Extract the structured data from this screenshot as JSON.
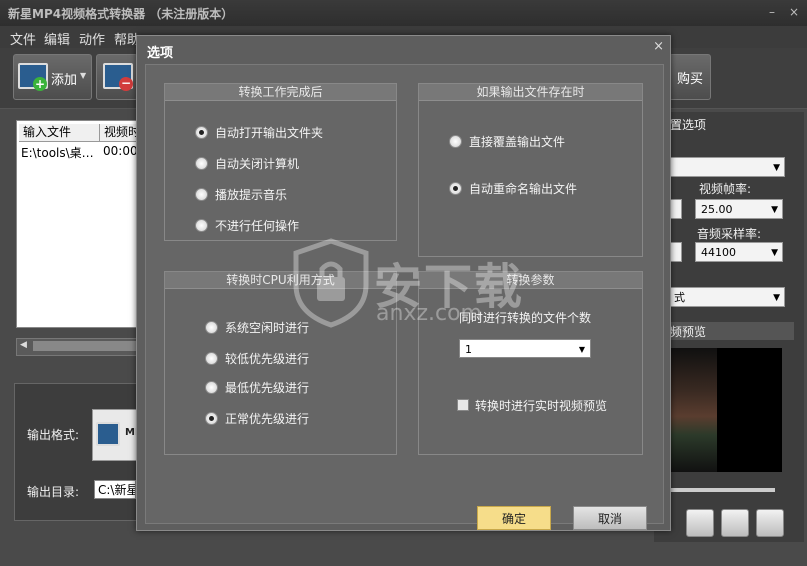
{
  "app": {
    "title": "新星MP4视频格式转换器 （未注册版本）",
    "menu": [
      "文件",
      "编辑",
      "动作",
      "帮助"
    ],
    "toolbar": {
      "add_label": "添加",
      "buy_label": "购买"
    }
  },
  "file_list": {
    "columns": [
      "输入文件",
      "视频时"
    ],
    "rows": [
      [
        "E:\\tools\\桌…",
        "00:00:"
      ]
    ]
  },
  "output": {
    "format_label": "输出格式:",
    "format_value": "MI",
    "dir_label": "输出目录:",
    "dir_value": "C:\\新星"
  },
  "right_panel": {
    "section_title": "置选项",
    "frame_rate_label": "视频帧率:",
    "frame_rate_value": "25.00",
    "audio_rate_label": "音频采样率:",
    "audio_rate_value": "44100",
    "mode_value": "式",
    "preview_title": "频预览"
  },
  "dialog": {
    "title": "选项",
    "close_symbol": "×",
    "groups": {
      "on_complete": {
        "title": "转换工作完成后",
        "options": [
          "自动打开输出文件夹",
          "自动关闭计算机",
          "播放提示音乐",
          "不进行任何操作"
        ],
        "selected": 0
      },
      "if_exists": {
        "title": "如果输出文件存在时",
        "options": [
          "直接覆盖输出文件",
          "自动重命名输出文件"
        ],
        "selected": 1
      },
      "cpu": {
        "title": "转换时CPU利用方式",
        "options": [
          "系统空闲时进行",
          "较低优先级进行",
          "最低优先级进行",
          "正常优先级进行"
        ],
        "selected": 3
      },
      "params": {
        "title": "转换参数",
        "concurrent_label": "同时进行转换的文件个数",
        "concurrent_value": "1",
        "preview_checkbox_label": "转换时进行实时视频预览",
        "preview_checked": false
      }
    },
    "ok_label": "确定",
    "cancel_label": "取消"
  },
  "watermark": {
    "text": "安下载",
    "subtext": "anxz.com"
  },
  "colors": {
    "ok_button": "#f6dd8a",
    "dialog_bg": "#5e5e5e",
    "window_bg": "#4a4a4a"
  }
}
